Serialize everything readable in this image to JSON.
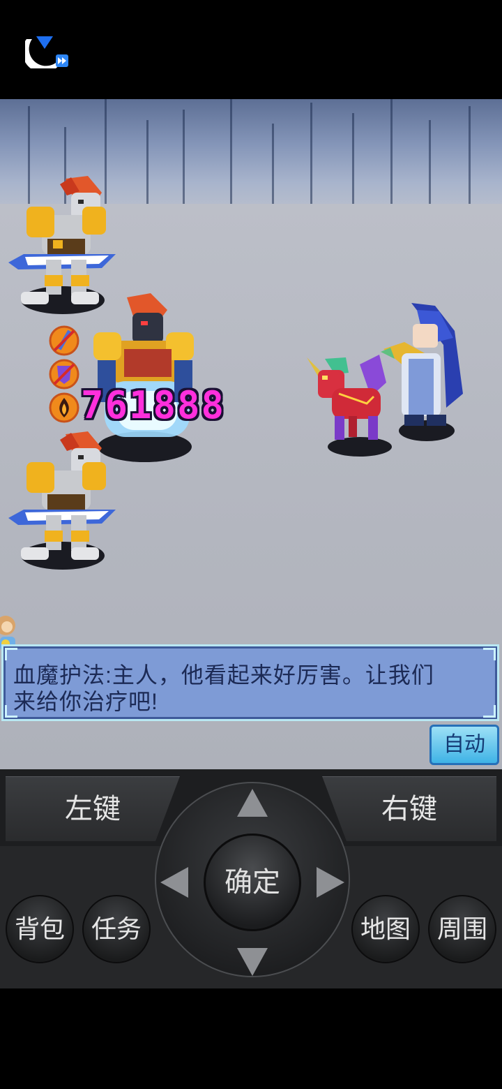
{
  "battle": {
    "damage_number": "761888"
  },
  "dialog": {
    "text_line1": "血魔护法:主人，他看起来好厉害。让我们",
    "text_line2": "来给你治疗吧!"
  },
  "auto_button": "自动",
  "controls": {
    "left_key": "左键",
    "right_key": "右键",
    "confirm": "确定",
    "bag": "背包",
    "tasks": "任务",
    "map": "地图",
    "surroundings": "周围"
  },
  "status_icons": [
    "sword-broken-icon",
    "shield-broken-icon",
    "fire-icon"
  ],
  "colors": {
    "damage": "#ff2fdc",
    "dialog_bg": "#7e9bd6",
    "auto_button": "#3fb3e6"
  }
}
